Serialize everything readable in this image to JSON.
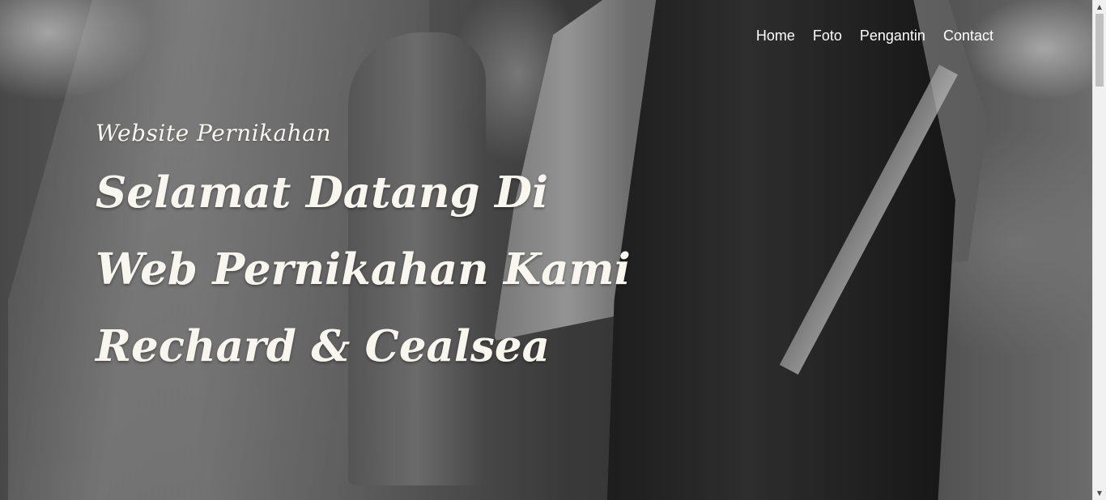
{
  "nav": {
    "items": [
      {
        "label": "Home"
      },
      {
        "label": "Foto"
      },
      {
        "label": "Pengantin"
      },
      {
        "label": "Contact"
      }
    ]
  },
  "hero": {
    "tagline": "Website Pernikahan",
    "headline": [
      "Selamat Datang Di",
      "Web Pernikahan Kami",
      "Rechard &  Cealsea"
    ]
  },
  "scrollbar": {
    "up_icon": "scroll-up-arrow",
    "down_icon": "scroll-down-arrow"
  },
  "colors": {
    "nav_text": "#ffffff",
    "hero_text": "#f8f6ee",
    "scrollbar_track": "#f1f1f1",
    "scrollbar_thumb": "#c1c1c1"
  }
}
